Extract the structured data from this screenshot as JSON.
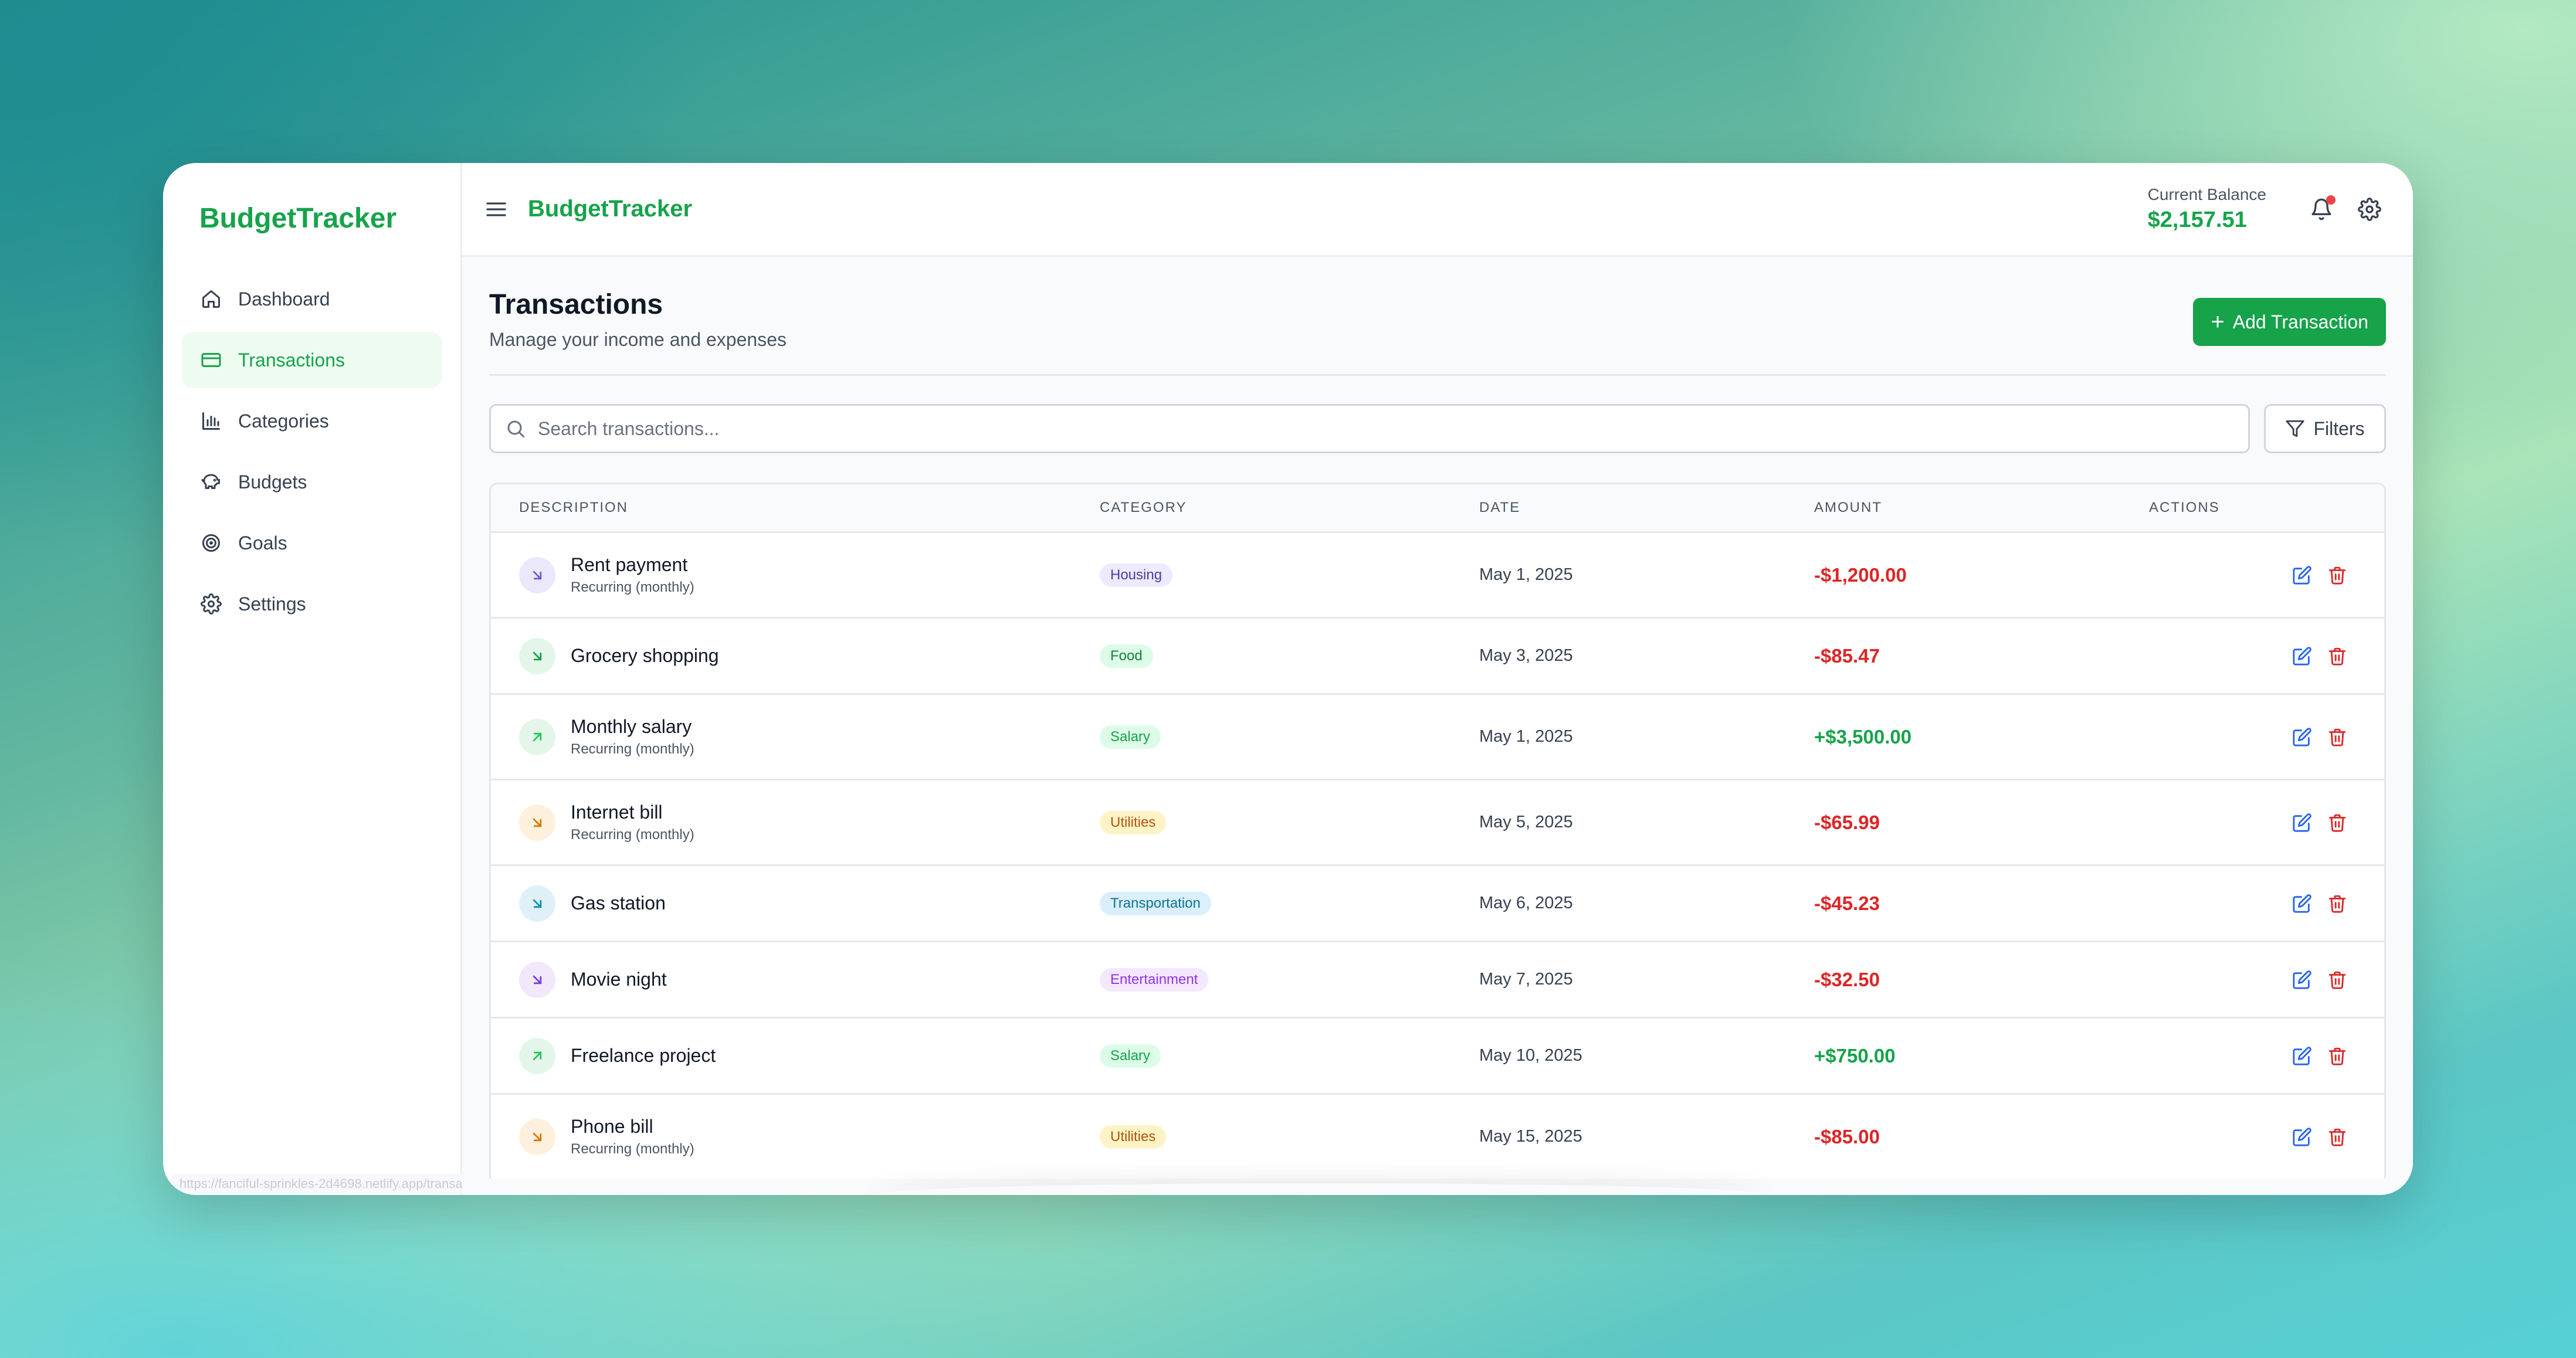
{
  "sidebar": {
    "brand": "BudgetTracker",
    "items": [
      {
        "label": "Dashboard",
        "icon": "home-icon",
        "active": false
      },
      {
        "label": "Transactions",
        "icon": "credit-card-icon",
        "active": true
      },
      {
        "label": "Categories",
        "icon": "bar-chart-icon",
        "active": false
      },
      {
        "label": "Budgets",
        "icon": "piggy-bank-icon",
        "active": false
      },
      {
        "label": "Goals",
        "icon": "target-icon",
        "active": false
      },
      {
        "label": "Settings",
        "icon": "gear-icon",
        "active": false
      }
    ],
    "status_url": "https://fanciful-sprinkles-2d4698.netlify.app/transactions"
  },
  "header": {
    "brand": "BudgetTracker",
    "balance_label": "Current Balance",
    "balance_value": "$2,157.51"
  },
  "page": {
    "title": "Transactions",
    "subtitle": "Manage your income and expenses",
    "add_button": "Add Transaction"
  },
  "search": {
    "placeholder": "Search transactions...",
    "value": "",
    "filters_label": "Filters"
  },
  "table": {
    "headers": {
      "description": "Description",
      "category": "Category",
      "date": "Date",
      "amount": "Amount",
      "actions": "Actions"
    },
    "rows": [
      {
        "title": "Rent payment",
        "sub": "Recurring (monthly)",
        "category": "Housing",
        "date": "May 1, 2025",
        "amount": "-$1,200.00",
        "type": "expense"
      },
      {
        "title": "Grocery shopping",
        "sub": "",
        "category": "Food",
        "date": "May 3, 2025",
        "amount": "-$85.47",
        "type": "expense"
      },
      {
        "title": "Monthly salary",
        "sub": "Recurring (monthly)",
        "category": "Salary",
        "date": "May 1, 2025",
        "amount": "+$3,500.00",
        "type": "income"
      },
      {
        "title": "Internet bill",
        "sub": "Recurring (monthly)",
        "category": "Utilities",
        "date": "May 5, 2025",
        "amount": "-$65.99",
        "type": "expense"
      },
      {
        "title": "Gas station",
        "sub": "",
        "category": "Transportation",
        "date": "May 6, 2025",
        "amount": "-$45.23",
        "type": "expense"
      },
      {
        "title": "Movie night",
        "sub": "",
        "category": "Entertainment",
        "date": "May 7, 2025",
        "amount": "-$32.50",
        "type": "expense"
      },
      {
        "title": "Freelance project",
        "sub": "",
        "category": "Salary",
        "date": "May 10, 2025",
        "amount": "+$750.00",
        "type": "income"
      },
      {
        "title": "Phone bill",
        "sub": "Recurring (monthly)",
        "category": "Utilities",
        "date": "May 15, 2025",
        "amount": "-$85.00",
        "type": "expense"
      }
    ]
  },
  "colors": {
    "brand": "#16a34a",
    "expense": "#dc2626",
    "income": "#16a34a",
    "categories": {
      "Housing": {
        "bg": "#ede9fe",
        "fg": "#4c3d9e",
        "icon_bg": "#ece8fb",
        "icon_fg": "#6d5bd0"
      },
      "Food": {
        "bg": "#dcfce7",
        "fg": "#15803d",
        "icon_bg": "#e3f6e9",
        "icon_fg": "#16a34a"
      },
      "Salary": {
        "bg": "#dcfce7",
        "fg": "#16a34a",
        "icon_bg": "#e3f6e9",
        "icon_fg": "#22c55e"
      },
      "Utilities": {
        "bg": "#fef3c7",
        "fg": "#b45309",
        "icon_bg": "#fdf0dc",
        "icon_fg": "#d97706"
      },
      "Transportation": {
        "bg": "#dbeefb",
        "fg": "#0e7490",
        "icon_bg": "#dff1f7",
        "icon_fg": "#0891b2"
      },
      "Entertainment": {
        "bg": "#f3e8ff",
        "fg": "#9333ea",
        "icon_bg": "#f1e8fc",
        "icon_fg": "#7c3aed"
      }
    }
  }
}
